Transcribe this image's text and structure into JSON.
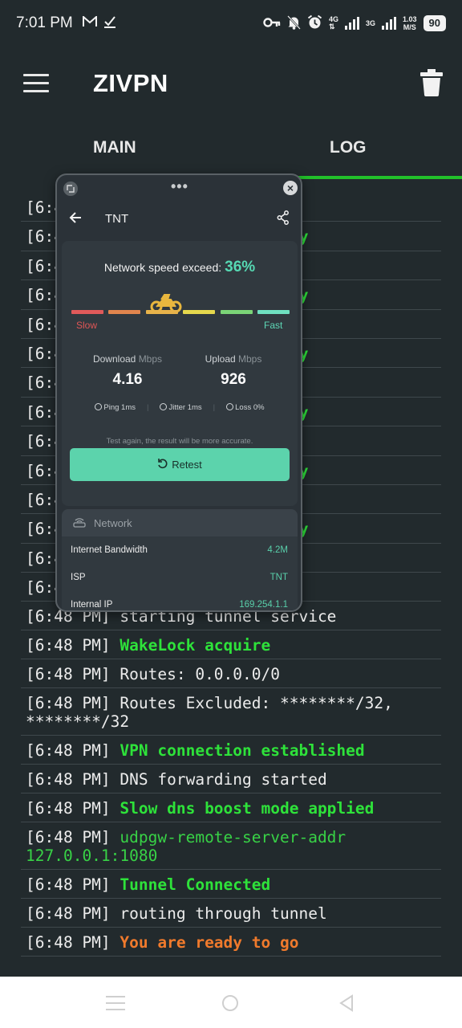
{
  "statusbar": {
    "time": "7:01 PM",
    "net_4g": "4G",
    "net_3g": "3G",
    "speed_value": "1.03",
    "speed_unit": "M/S",
    "battery": "90"
  },
  "appbar": {
    "title": "ZIVPN"
  },
  "tabs": {
    "main": "MAIN",
    "log": "LOG",
    "active": "LOG"
  },
  "log": [
    {
      "ts": "[6:48 PM] ",
      "msg": "starting tunnel service",
      "color": "white"
    },
    {
      "ts": "[6:48 PM] ",
      "msg": "WakeLock acquire",
      "color": "green"
    },
    {
      "ts": "[6:48 PM] ",
      "msg": "Routes: 0.0.0.0/0",
      "color": "white"
    },
    {
      "ts": "[6:48 PM] ",
      "msg": "Routes Excluded: ********/32,\n********/32",
      "color": "white"
    },
    {
      "ts": "[6:48 PM] ",
      "msg": "VPN connection established",
      "color": "green"
    },
    {
      "ts": "[6:48 PM] ",
      "msg": "DNS forwarding started",
      "color": "white"
    },
    {
      "ts": "[6:48 PM] ",
      "msg": "Slow dns boost mode applied",
      "color": "green"
    },
    {
      "ts": "[6:48 PM] ",
      "msg": "udpgw-remote-server-addr\n127.0.0.1:1080",
      "color": "lgreen"
    },
    {
      "ts": "[6:48 PM] ",
      "msg": "Tunnel Connected",
      "color": "green"
    },
    {
      "ts": "[6:48 PM] ",
      "msg": "routing through tunnel",
      "color": "white"
    },
    {
      "ts": "[6:48 PM] ",
      "msg": "You are ready to go",
      "color": "orange"
    }
  ],
  "log_hidden_rows": [
    {
      "ts": "[6:4",
      "tail": ":",
      "color": "white"
    },
    {
      "ts": "[6:4",
      "tail": "ay",
      "color": "green"
    },
    {
      "ts": "[6:4",
      "tail": ":",
      "color": "white"
    },
    {
      "ts": "[6:4",
      "tail": "ay",
      "color": "green"
    },
    {
      "ts": "[6:4",
      "tail": ":",
      "color": "white"
    },
    {
      "ts": "[6:4",
      "tail": "ay",
      "color": "green"
    },
    {
      "ts": "[6:4",
      "tail": ":",
      "color": "white"
    },
    {
      "ts": "[6:4",
      "tail": "ay",
      "color": "green"
    },
    {
      "ts": "[6:4",
      "tail": ":",
      "color": "white"
    },
    {
      "ts": "[6:4",
      "tail": "ay",
      "color": "green"
    },
    {
      "ts": "[6:4",
      "tail": ":",
      "color": "white"
    },
    {
      "ts": "[6:4",
      "tail": "ay",
      "color": "green"
    },
    {
      "ts": "[6:4",
      "tail": ":",
      "color": "white"
    },
    {
      "ts": "[6:4",
      "tail": "",
      "color": "white"
    }
  ],
  "overlay": {
    "dots": "•••",
    "close": "×",
    "header_title": "TNT",
    "exceed_label": "Network speed exceed:",
    "exceed_value": "36%",
    "exceed_fraction": 0.36,
    "slow_label": "Slow",
    "fast_label": "Fast",
    "segment_colors": [
      "#e05a5a",
      "#e1854d",
      "#e8b34a",
      "#e6d84d",
      "#7bd477",
      "#6fe0c0"
    ],
    "download": {
      "label": "Download",
      "unit": "Mbps",
      "value": "4.16"
    },
    "upload": {
      "label": "Upload",
      "unit": "Mbps",
      "value": "926"
    },
    "ping": "Ping 1ms",
    "jitter": "Jitter 1ms",
    "loss": "Loss 0%",
    "hint": "Test again, the result will be more accurate.",
    "retest_label": "Retest",
    "network_title": "Network",
    "network_rows": [
      {
        "label": "Internet Bandwidth",
        "value": "4.2M"
      },
      {
        "label": "ISP",
        "value": "TNT"
      },
      {
        "label": "Internal IP",
        "value": "169.254.1.1"
      }
    ]
  },
  "colors": {
    "accent_green": "#22c02a",
    "log_green": "#2ee23a",
    "log_orange": "#f07a2c",
    "retest_bg": "#5cd3ac"
  }
}
